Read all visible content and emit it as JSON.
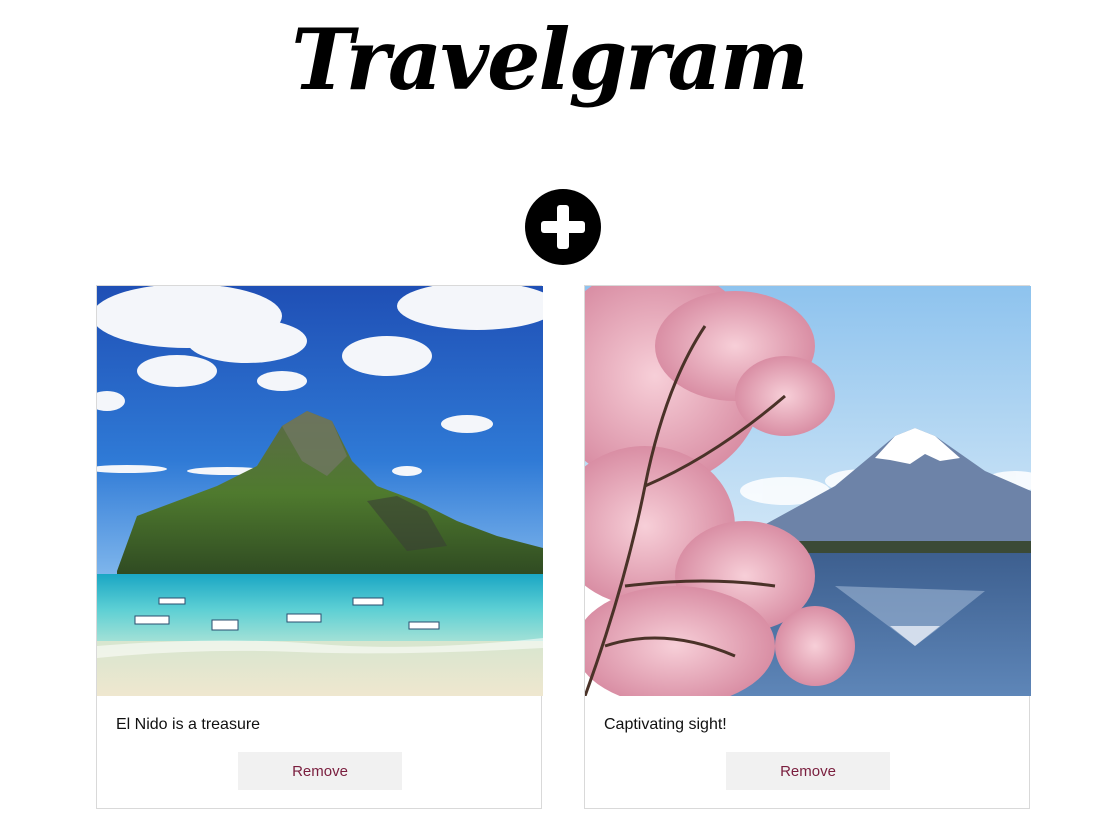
{
  "app": {
    "title": "Travelgram"
  },
  "toolbar": {
    "add_icon": "plus-circle-icon"
  },
  "colors": {
    "accent": "#7a1e3e",
    "button_bg": "#f1f1f1",
    "card_border": "#d9d9d9"
  },
  "posts": [
    {
      "caption": "El Nido is a treasure",
      "remove_label": "Remove",
      "image": "tropical-island-photo"
    },
    {
      "caption": "Captivating sight!",
      "remove_label": "Remove",
      "image": "mount-fuji-cherry-blossom-photo"
    }
  ]
}
